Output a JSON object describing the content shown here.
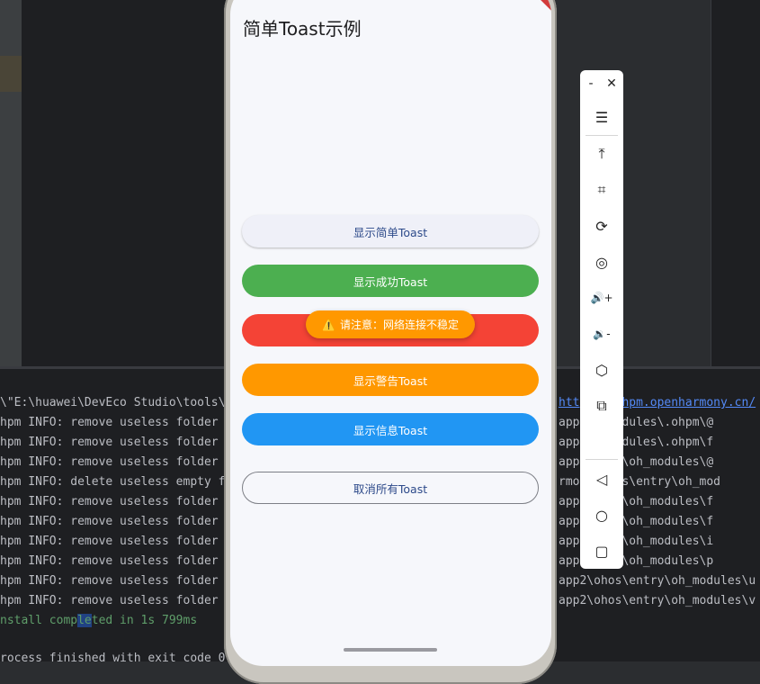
{
  "app": {
    "page_title": "简单Toast示例",
    "buttons": {
      "simple": "显示简单Toast",
      "success": "显示成功Toast",
      "warning": "显示警告Toast",
      "info": "显示信息Toast",
      "cancel": "取消所有Toast"
    },
    "toast": {
      "icon": "⚠️",
      "text": "请注意：网络连接不稳定"
    }
  },
  "console": {
    "lines": [
      "\\\"E:\\huawei\\DevEco Studio\\tools\\",
      "hpm INFO: remove useless folder",
      "hpm INFO: remove useless folder",
      "hpm INFO: remove useless folder",
      "hpm INFO: delete useless empty f",
      "hpm INFO: remove useless folder",
      "hpm INFO: remove useless folder",
      "hpm INFO: remove useless folder",
      "hpm INFO: remove useless folder",
      "hpm INFO: remove useless folder",
      "hpm INFO: remove useless folder"
    ],
    "install_before": "nstall comp",
    "install_sel": "le",
    "install_after": "ted in 1s 799ms",
    "process_line": "rocess finished with exit code 0",
    "right_lines": [
      "https://ohpm.openharmony.cn/",
      "app\\oh_modules\\.ohpm\\@",
      "app\\oh_modules\\.ohpm\\f",
      "app\\entry\\oh_modules\\@",
      "rmo 2\\ohos\\entry\\oh_mod",
      "app\\entry\\oh_modules\\f",
      "app\\entry\\oh_modules\\f",
      "app\\entry\\oh_modules\\i",
      "app\\entry\\oh_modules\\p",
      "app2\\ohos\\entry\\oh_modules\\u",
      "app2\\ohos\\entry\\oh_modules\\v"
    ]
  },
  "toolbar": {
    "minimize": "-",
    "close": "✕",
    "menu": "☰",
    "to_top": "⤒",
    "crop": "⌗",
    "rotate": "⟳",
    "screenshot": "◎",
    "volume_up": "🔊+",
    "volume_down": "🔉-",
    "shake": "⬡",
    "multi_device": "⧉",
    "back": "◁",
    "home": "○",
    "recent": "▢"
  },
  "colors": {
    "success": "#4caf50",
    "error": "#f44336",
    "warning": "#ff9800",
    "info": "#2196f3"
  }
}
